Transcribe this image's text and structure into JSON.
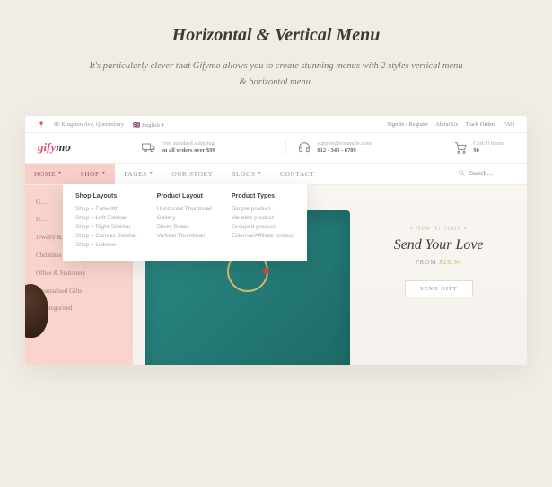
{
  "headline": "Horizontal & Vertical Menu",
  "subhead": "It's particularly clever that Gifymo allows you to create stunning menus with 2 styles vertical menu & horizontal menu.",
  "topbar": {
    "address": "86 Kingston Ave, Queensbury",
    "language": "English",
    "links": [
      "Sign In / Register",
      "About Us",
      "Track Orders",
      "FAQ"
    ]
  },
  "logo": {
    "part1": "gify",
    "part2": "mo"
  },
  "info": {
    "shipping": {
      "line1": "Free standard shipping",
      "line2": "on all orders over $99"
    },
    "support": {
      "line1": "support@example.com",
      "line2": "012 - 345 - 6789"
    },
    "cart": {
      "line1": "Cart: 0 items",
      "line2": "$0"
    }
  },
  "nav": [
    "HOME",
    "SHOP",
    "PAGES",
    "OUR STORY",
    "BLOGS",
    "CONTACT"
  ],
  "search_placeholder": "Search…",
  "mega": {
    "col1": {
      "title": "Shop Layouts",
      "items": [
        "Shop – Fullwidth",
        "Shop – Left Sidebar",
        "Shop – Right Sidebar",
        "Shop – Canvas Sidebar",
        "Shop – Listview"
      ]
    },
    "col2": {
      "title": "Product Layout",
      "items": [
        "Horizontal Thumbnail",
        "Gallery",
        "Sticky Detail",
        "Vertical Thumbnail"
      ]
    },
    "col3": {
      "title": "Product Types",
      "items": [
        "Simple product",
        "Variable product",
        "Grouped product",
        "External/Affiliate product"
      ]
    }
  },
  "sidebar": [
    "G…",
    "H…",
    "Jewelry & …",
    "Christmas Gifts",
    "Office & Stationery",
    "Personalised Gifts",
    "Uncategorised"
  ],
  "hero": {
    "eyebrow": "« New Arrivals »",
    "title": "Send Your Love",
    "price_label": "FROM",
    "price": "$29.90",
    "button": "SEND GIFT"
  }
}
